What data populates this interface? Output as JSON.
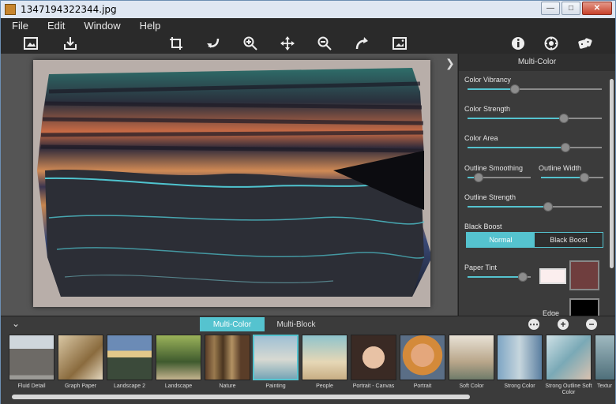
{
  "window": {
    "title": "1347194322344.jpg",
    "controls": [
      "minimize",
      "maximize",
      "close"
    ]
  },
  "menu": [
    "File",
    "Edit",
    "Window",
    "Help"
  ],
  "toolbar": {
    "icons": [
      "open-image-icon",
      "save-icon",
      "crop-icon",
      "undo-icon",
      "zoom-in-icon",
      "move-icon",
      "zoom-out-icon",
      "redo-icon",
      "fit-view-icon",
      "info-icon",
      "settings-icon",
      "random-dice-icon"
    ]
  },
  "panel": {
    "title": "Multi-Color",
    "controls": {
      "color_vibrancy": {
        "label": "Color Vibrancy",
        "value": 0.35
      },
      "color_strength": {
        "label": "Color Strength",
        "value": 0.72
      },
      "color_area": {
        "label": "Color Area",
        "value": 0.73
      },
      "outline_smoothing": {
        "label": "Outline Smoothing",
        "value": 0.18
      },
      "outline_width": {
        "label": "Outline Width",
        "value": 0.7
      },
      "outline_strength": {
        "label": "Outline Strength",
        "value": 0.6
      },
      "black_boost": {
        "label": "Black Boost",
        "options": [
          "Normal",
          "Black Boost"
        ],
        "selected": "Normal"
      },
      "paper_tint": {
        "label": "Paper Tint",
        "value": 0.88
      },
      "edge": {
        "label": "Edge"
      }
    },
    "colors": {
      "accent": "#55c3cf",
      "tint_light": "#fbeeee",
      "tint_color": "#6f3e3e"
    }
  },
  "bottom": {
    "tabs": [
      "Multi-Color",
      "Multi-Block"
    ],
    "active_tab": "Multi-Color",
    "presets": [
      {
        "label": "Fluid Detail"
      },
      {
        "label": "Graph Paper"
      },
      {
        "label": "Landscape 2"
      },
      {
        "label": "Landscape"
      },
      {
        "label": "Nature"
      },
      {
        "label": "Painting",
        "selected": true
      },
      {
        "label": "People"
      },
      {
        "label": "Portrait - Canvas"
      },
      {
        "label": "Portrait"
      },
      {
        "label": "Soft Color"
      },
      {
        "label": "Strong Color"
      },
      {
        "label": "Strong Outline Soft Color"
      },
      {
        "label": "Textur"
      }
    ]
  }
}
